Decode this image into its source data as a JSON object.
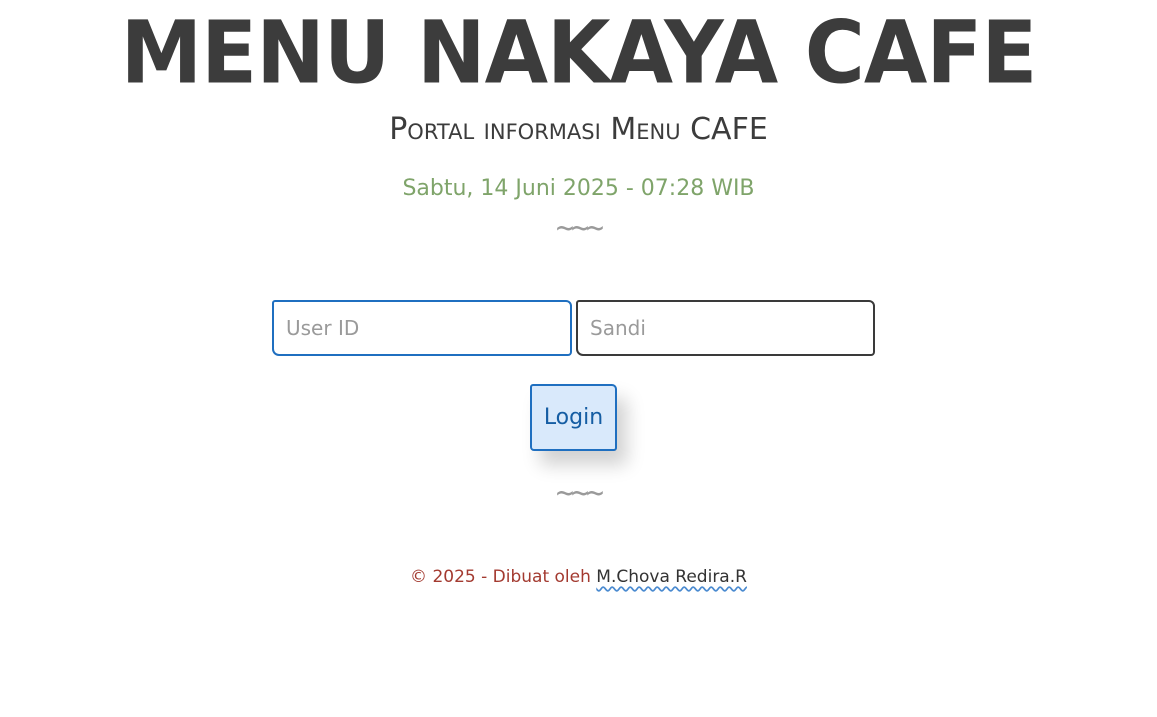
{
  "header": {
    "title": "MENU NAKAYA CAFE",
    "subtitle": "Portal informasi Menu CAFE",
    "datetime": "Sabtu, 14 Juni 2025 - 07:28 WIB",
    "divider": "~~~"
  },
  "login_form": {
    "user_id_placeholder": "User ID",
    "user_id_value": "",
    "password_placeholder": "Sandi",
    "password_value": "",
    "login_label": "Login"
  },
  "footer": {
    "divider": "~~~",
    "copyright_text": "© 2025 - Dibuat oleh",
    "author_link": "M.Chova Redira.R"
  },
  "colors": {
    "title": "#3c3c3c",
    "datetime": "#7fa46a",
    "accent": "#1f6fc0",
    "button_bg": "#d9e9fb",
    "footer_text": "#a33a30"
  }
}
